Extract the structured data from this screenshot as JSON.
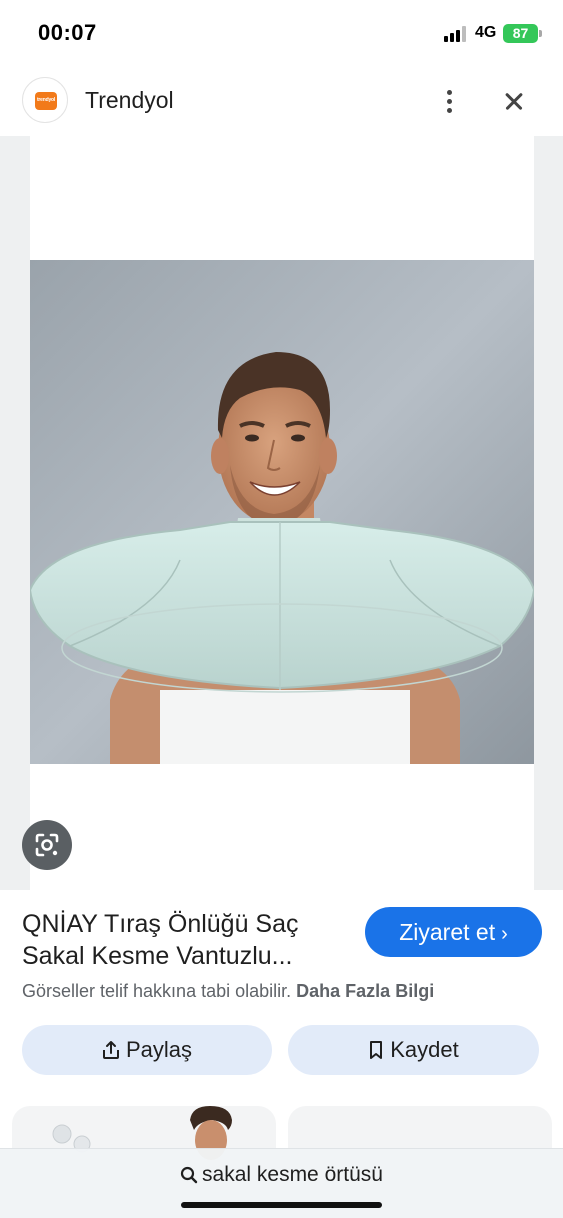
{
  "status_bar": {
    "time": "00:07",
    "network": "4G",
    "battery": "87"
  },
  "source": {
    "logo_text": "trendyol",
    "name": "Trendyol"
  },
  "result": {
    "title": "QNİAY Tıraş Önlüğü Saç Sakal Kesme Vantuzlu...",
    "visit_label": "Ziyaret et",
    "copyright_text": "Görseller telif hakkına tabi olabilir.",
    "more_info_label": "Daha Fazla Bilgi",
    "share_label": "Paylaş",
    "save_label": "Kaydet"
  },
  "search": {
    "query": "sakal kesme örtüsü"
  },
  "icons": {
    "more": "more-vertical-icon",
    "close": "close-icon",
    "lens": "google-lens-icon",
    "share": "share-icon",
    "save": "bookmark-icon",
    "search": "search-icon"
  },
  "colors": {
    "accent": "#1a73e8",
    "action_bg": "#e2ebf9",
    "brand": "#f27a1a",
    "battery": "#34c759"
  }
}
